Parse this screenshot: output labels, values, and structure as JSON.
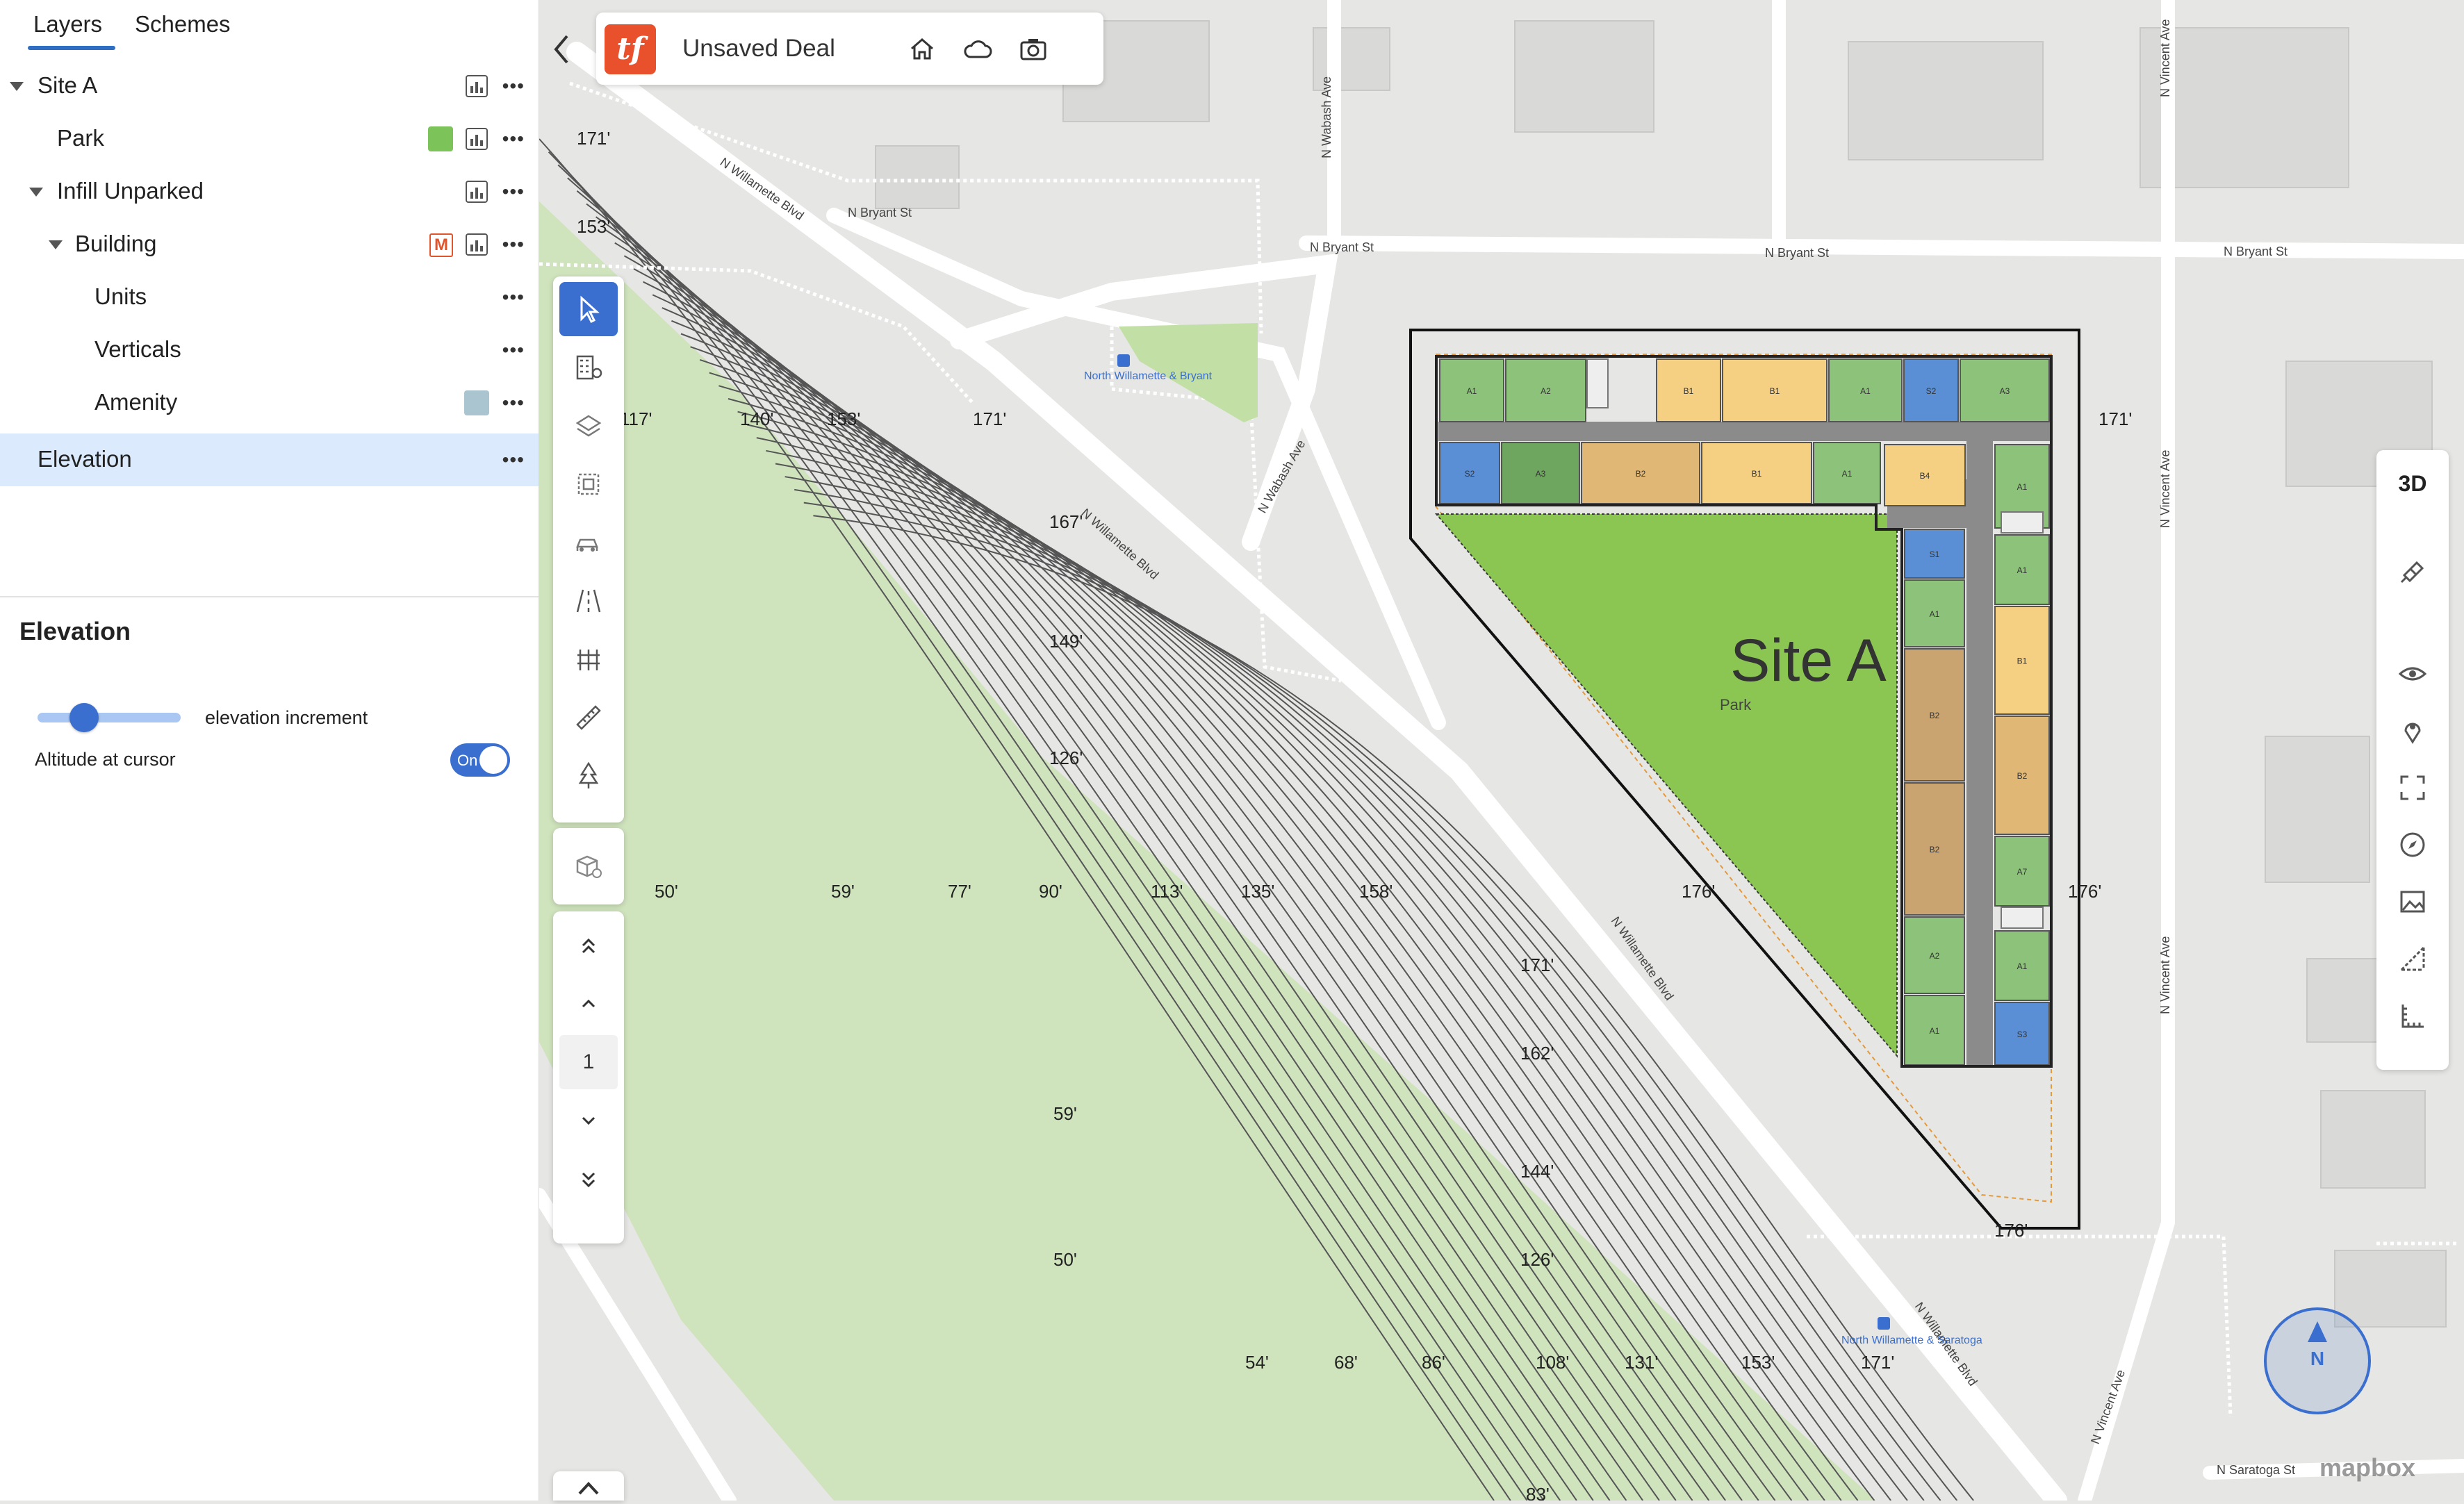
{
  "panel": {
    "tabs": [
      {
        "label": "Layers",
        "active": true
      },
      {
        "label": "Schemes",
        "active": false
      }
    ],
    "tree": [
      {
        "label": "Site A"
      },
      {
        "label": "Park",
        "swatch": "#7cc35a"
      },
      {
        "label": "Infill Unparked"
      },
      {
        "label": "Building",
        "badge": "M"
      },
      {
        "label": "Units"
      },
      {
        "label": "Verticals"
      },
      {
        "label": "Amenity",
        "swatch": "#aac4d0"
      },
      {
        "label": "Elevation",
        "selected": true
      }
    ],
    "details": {
      "title": "Elevation",
      "slider_label": "elevation increment",
      "altitude_label": "Altitude at cursor",
      "toggle_text": "On"
    }
  },
  "header": {
    "logo_text": "tf",
    "title": "Unsaved Deal",
    "icons": [
      "home-icon",
      "cloud-icon",
      "camera-icon"
    ]
  },
  "toolbar": {
    "tools": [
      "select-arrow-icon",
      "building-pin-icon",
      "layers-stack-icon",
      "cube-outline-icon",
      "parking-car-icon",
      "road-icon",
      "fence-icon",
      "ruler-icon",
      "tree-icon"
    ],
    "add_block_icon": "box-plus-icon",
    "floor_value": "1"
  },
  "right_toolbar": {
    "mode_3d": "3D",
    "icons": [
      "satellite-icon",
      "eye-icon",
      "location-pin-icon",
      "fullscreen-icon",
      "compass-icon",
      "image-icon",
      "measure-icon",
      "ruler-scale-icon"
    ]
  },
  "map": {
    "site_label": "Site A",
    "park_label": "Park",
    "streets": [
      "N Willamette Blvd",
      "N Bryant St",
      "N Bryant St",
      "N Bryant St",
      "N Bryant St",
      "N Wabash Ave",
      "N Wabash Ave",
      "N Vincent Ave",
      "N Vincent Ave",
      "N Vincent Ave",
      "N Willamette Blvd",
      "N Willamette Blvd",
      "N Willamette Blvd",
      "N Vincent Ave",
      "N Saratoga St"
    ],
    "pois": [
      "North Willamette & Bryant",
      "North Willamette & Saratoga"
    ],
    "contour_labels": [
      "171'",
      "153'",
      "117'",
      "140'",
      "153'",
      "171'",
      "167'",
      "149'",
      "126'",
      "50'",
      "59'",
      "77'",
      "90'",
      "113'",
      "135'",
      "158'",
      "176'",
      "171'",
      "162'",
      "59'",
      "144'",
      "50'",
      "126'",
      "54'",
      "68'",
      "86'",
      "108'",
      "131'",
      "153'",
      "171'",
      "176'",
      "171'",
      "176'",
      "83'"
    ],
    "units": [
      "A1",
      "A2",
      "B1",
      "B1",
      "A1",
      "S2",
      "A3",
      "S2",
      "A3",
      "B2",
      "B1",
      "A1",
      "B4",
      "A1",
      "S1",
      "A1",
      "A1",
      "B1",
      "B2",
      "B2",
      "B2",
      "A7",
      "A2",
      "A1",
      "A1",
      "S3"
    ],
    "attribution": "mapbox"
  },
  "compass": {
    "label": "N"
  }
}
